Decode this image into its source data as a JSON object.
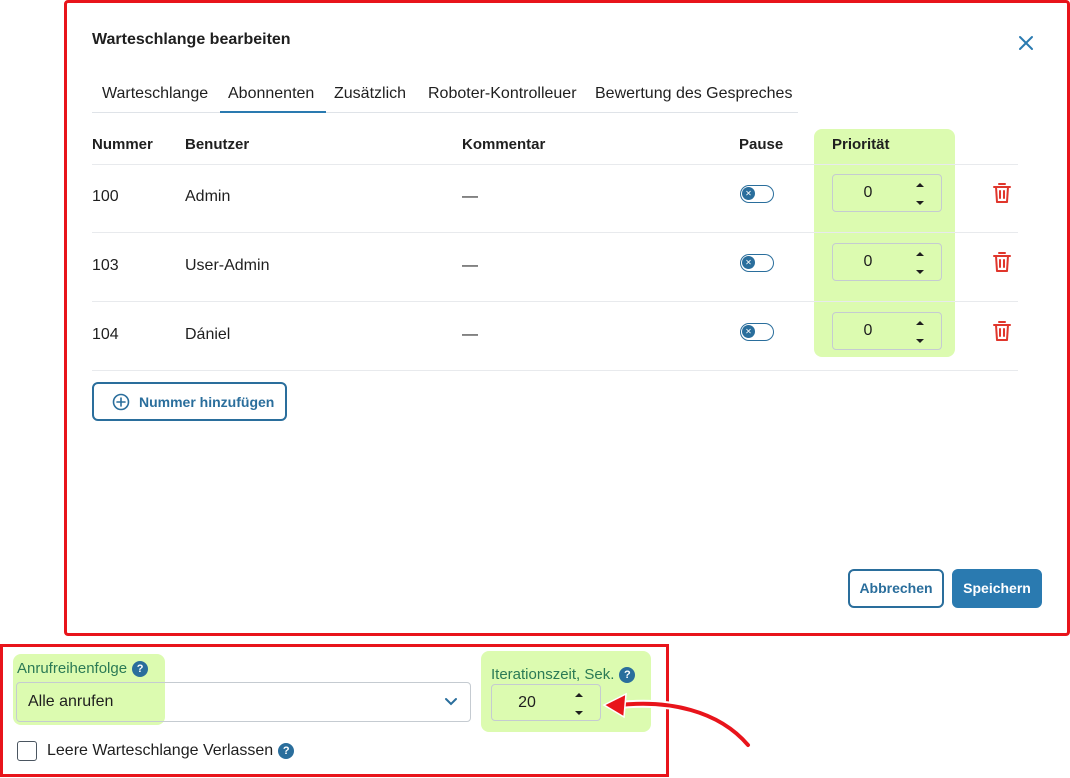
{
  "dialog": {
    "title": "Warteschlange bearbeiten",
    "tabs": [
      {
        "label": "Warteschlange",
        "active": false
      },
      {
        "label": "Abonnenten",
        "active": true
      },
      {
        "label": "Zusätzlich",
        "active": false
      },
      {
        "label": "Roboter-Kontrolleuer",
        "active": false
      },
      {
        "label": "Bewertung des Gespreches",
        "active": false
      }
    ],
    "table": {
      "columns": [
        "Nummer",
        "Benutzer",
        "Kommentar",
        "Pause",
        "Priorität"
      ],
      "rows": [
        {
          "number": "100",
          "user": "Admin",
          "comment": "—",
          "pause": false,
          "priority": "0"
        },
        {
          "number": "103",
          "user": "User-Admin",
          "comment": "—",
          "pause": false,
          "priority": "0"
        },
        {
          "number": "104",
          "user": "Dániel",
          "comment": "—",
          "pause": false,
          "priority": "0"
        }
      ]
    },
    "add_button_label": "Nummer hinzufügen",
    "cancel_label": "Abbrechen",
    "save_label": "Speichern"
  },
  "settings": {
    "call_order_label": "Anrufreihenfolge",
    "call_order_value": "Alle anrufen",
    "iteration_label": "Iterationszeit, Sek.",
    "iteration_value": "20",
    "leave_empty_label": "Leere Warteschlange Verlassen",
    "leave_empty_checked": false,
    "help_glyph": "?"
  },
  "colors": {
    "accent": "#2a7ab0",
    "annotation_frame": "#e8141b",
    "highlight": "#dcfbb0",
    "delete": "#e0362c",
    "label_green": "#2b7a55"
  },
  "icons": {
    "close": "close-icon",
    "delete": "trash-icon",
    "add": "plus-circle-icon",
    "dropdown": "chevron-down-icon",
    "help": "help-icon"
  }
}
